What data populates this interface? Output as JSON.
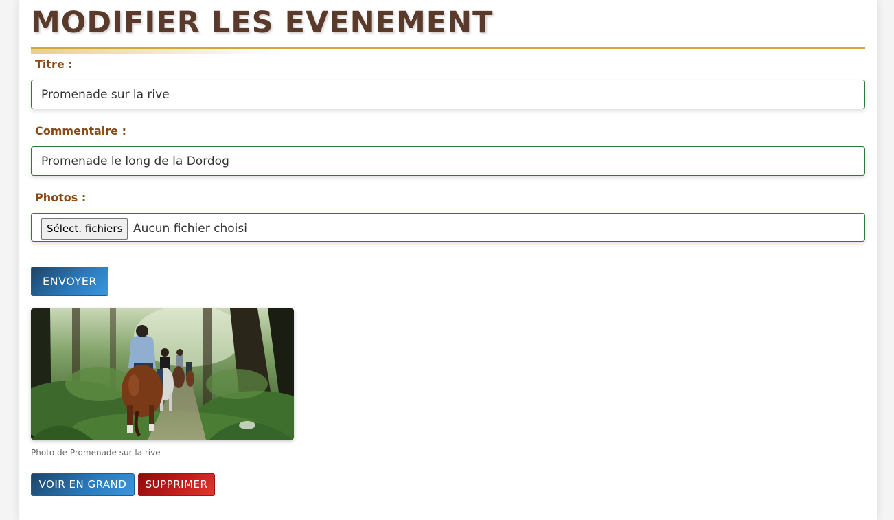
{
  "page": {
    "title": "MODIFIER LES EVENEMENT"
  },
  "form": {
    "title_label": "Titre :",
    "title_value": "Promenade sur la rive",
    "comment_label": "Commentaire :",
    "comment_value": "Promenade le long de la Dordog",
    "photos_label": "Photos :",
    "file_button_label": "Sélect. fichiers",
    "file_status": "Aucun fichier choisi",
    "submit_label": "ENVOYER"
  },
  "gallery": {
    "photo_caption": "Photo de Promenade sur la rive",
    "view_label": "VOIR EN GRAND",
    "delete_label": "SUPPRIMER"
  },
  "colors": {
    "title": "#5a3a2a",
    "accent_rule": "#d4a63a",
    "label": "#8b4a14",
    "field_border": "#2f7a3a",
    "primary_button": "#2a78b8",
    "danger_button": "#c11c1c"
  }
}
